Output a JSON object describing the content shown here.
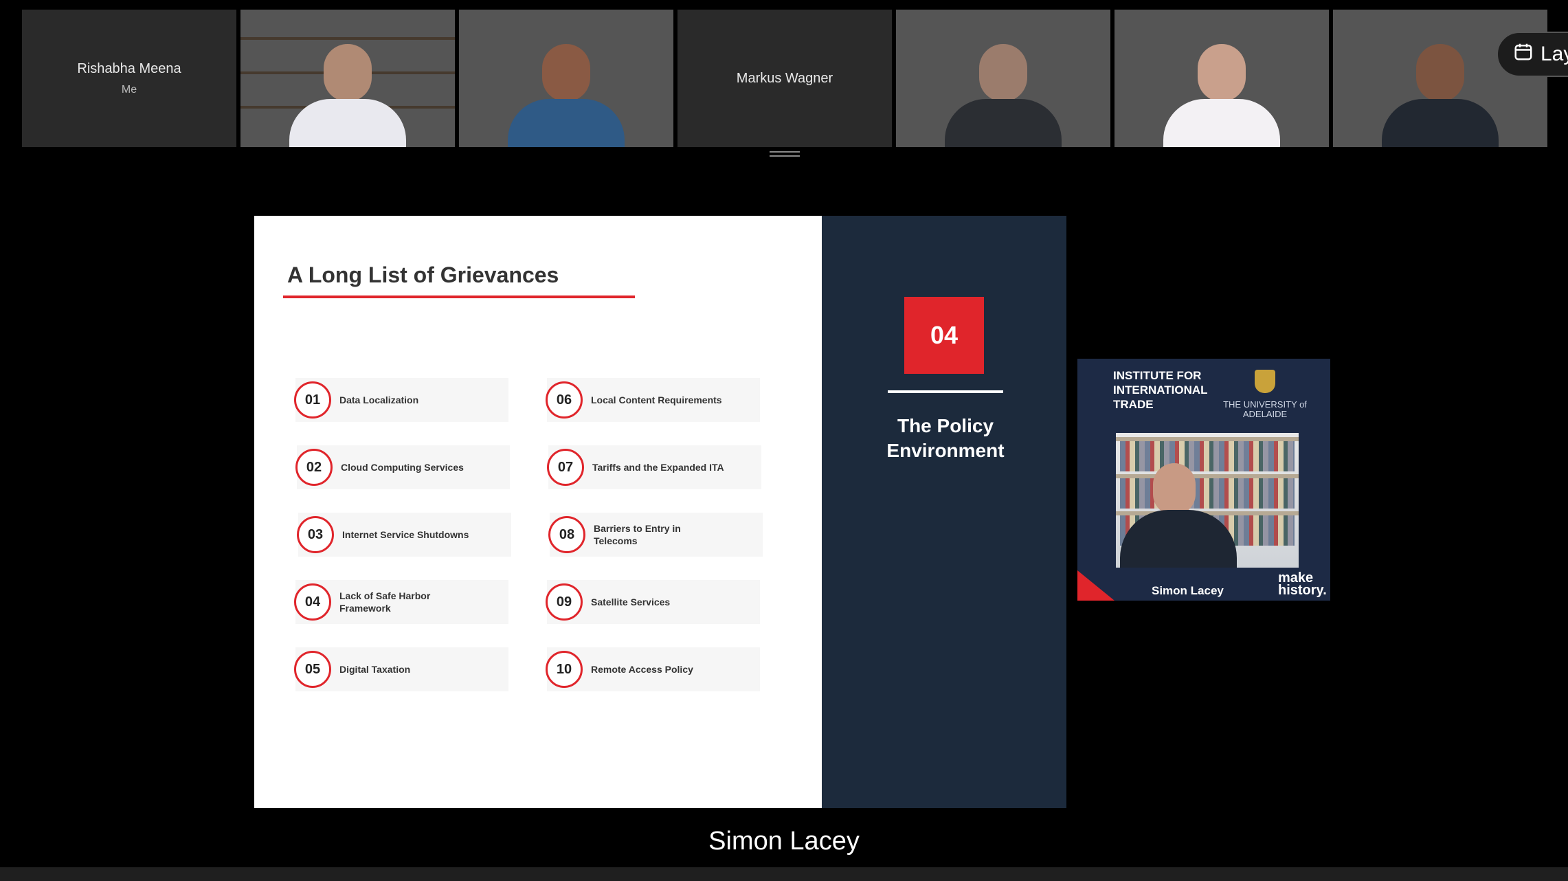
{
  "participants": [
    {
      "name": "Rishabha Meena",
      "sub": "Me",
      "video": false
    },
    {
      "name": "",
      "video": true
    },
    {
      "name": "",
      "video": true
    },
    {
      "name": "Markus Wagner",
      "video": false
    },
    {
      "name": "",
      "video": true
    },
    {
      "name": "",
      "video": true
    },
    {
      "name": "",
      "video": true
    }
  ],
  "layout_button": {
    "label": "Lay",
    "icon": "calendar-layout-icon"
  },
  "slide": {
    "title": "A Long List of Grievances",
    "items": [
      {
        "num": "01",
        "text": "Data Localization"
      },
      {
        "num": "02",
        "text": "Cloud Computing Services"
      },
      {
        "num": "03",
        "text": "Internet Service Shutdowns"
      },
      {
        "num": "04",
        "text": "Lack of Safe Harbor Framework"
      },
      {
        "num": "05",
        "text": "Digital Taxation"
      },
      {
        "num": "06",
        "text": "Local Content Requirements"
      },
      {
        "num": "07",
        "text": "Tariffs and the Expanded ITA"
      },
      {
        "num": "08",
        "text": "Barriers to Entry in Telecoms"
      },
      {
        "num": "09",
        "text": "Satellite Services"
      },
      {
        "num": "10",
        "text": "Remote Access Policy"
      }
    ],
    "section_number": "04",
    "section_title": "The Policy Environment",
    "accent_color": "#e0252b",
    "panel_color": "#1c2a3c"
  },
  "speaker_pip": {
    "institute": "INSTITUTE FOR INTERNATIONAL TRADE",
    "university": "THE UNIVERSITY of ADELAIDE",
    "name": "Simon Lacey",
    "tagline": "make history."
  },
  "speaker_label": "Simon Lacey"
}
